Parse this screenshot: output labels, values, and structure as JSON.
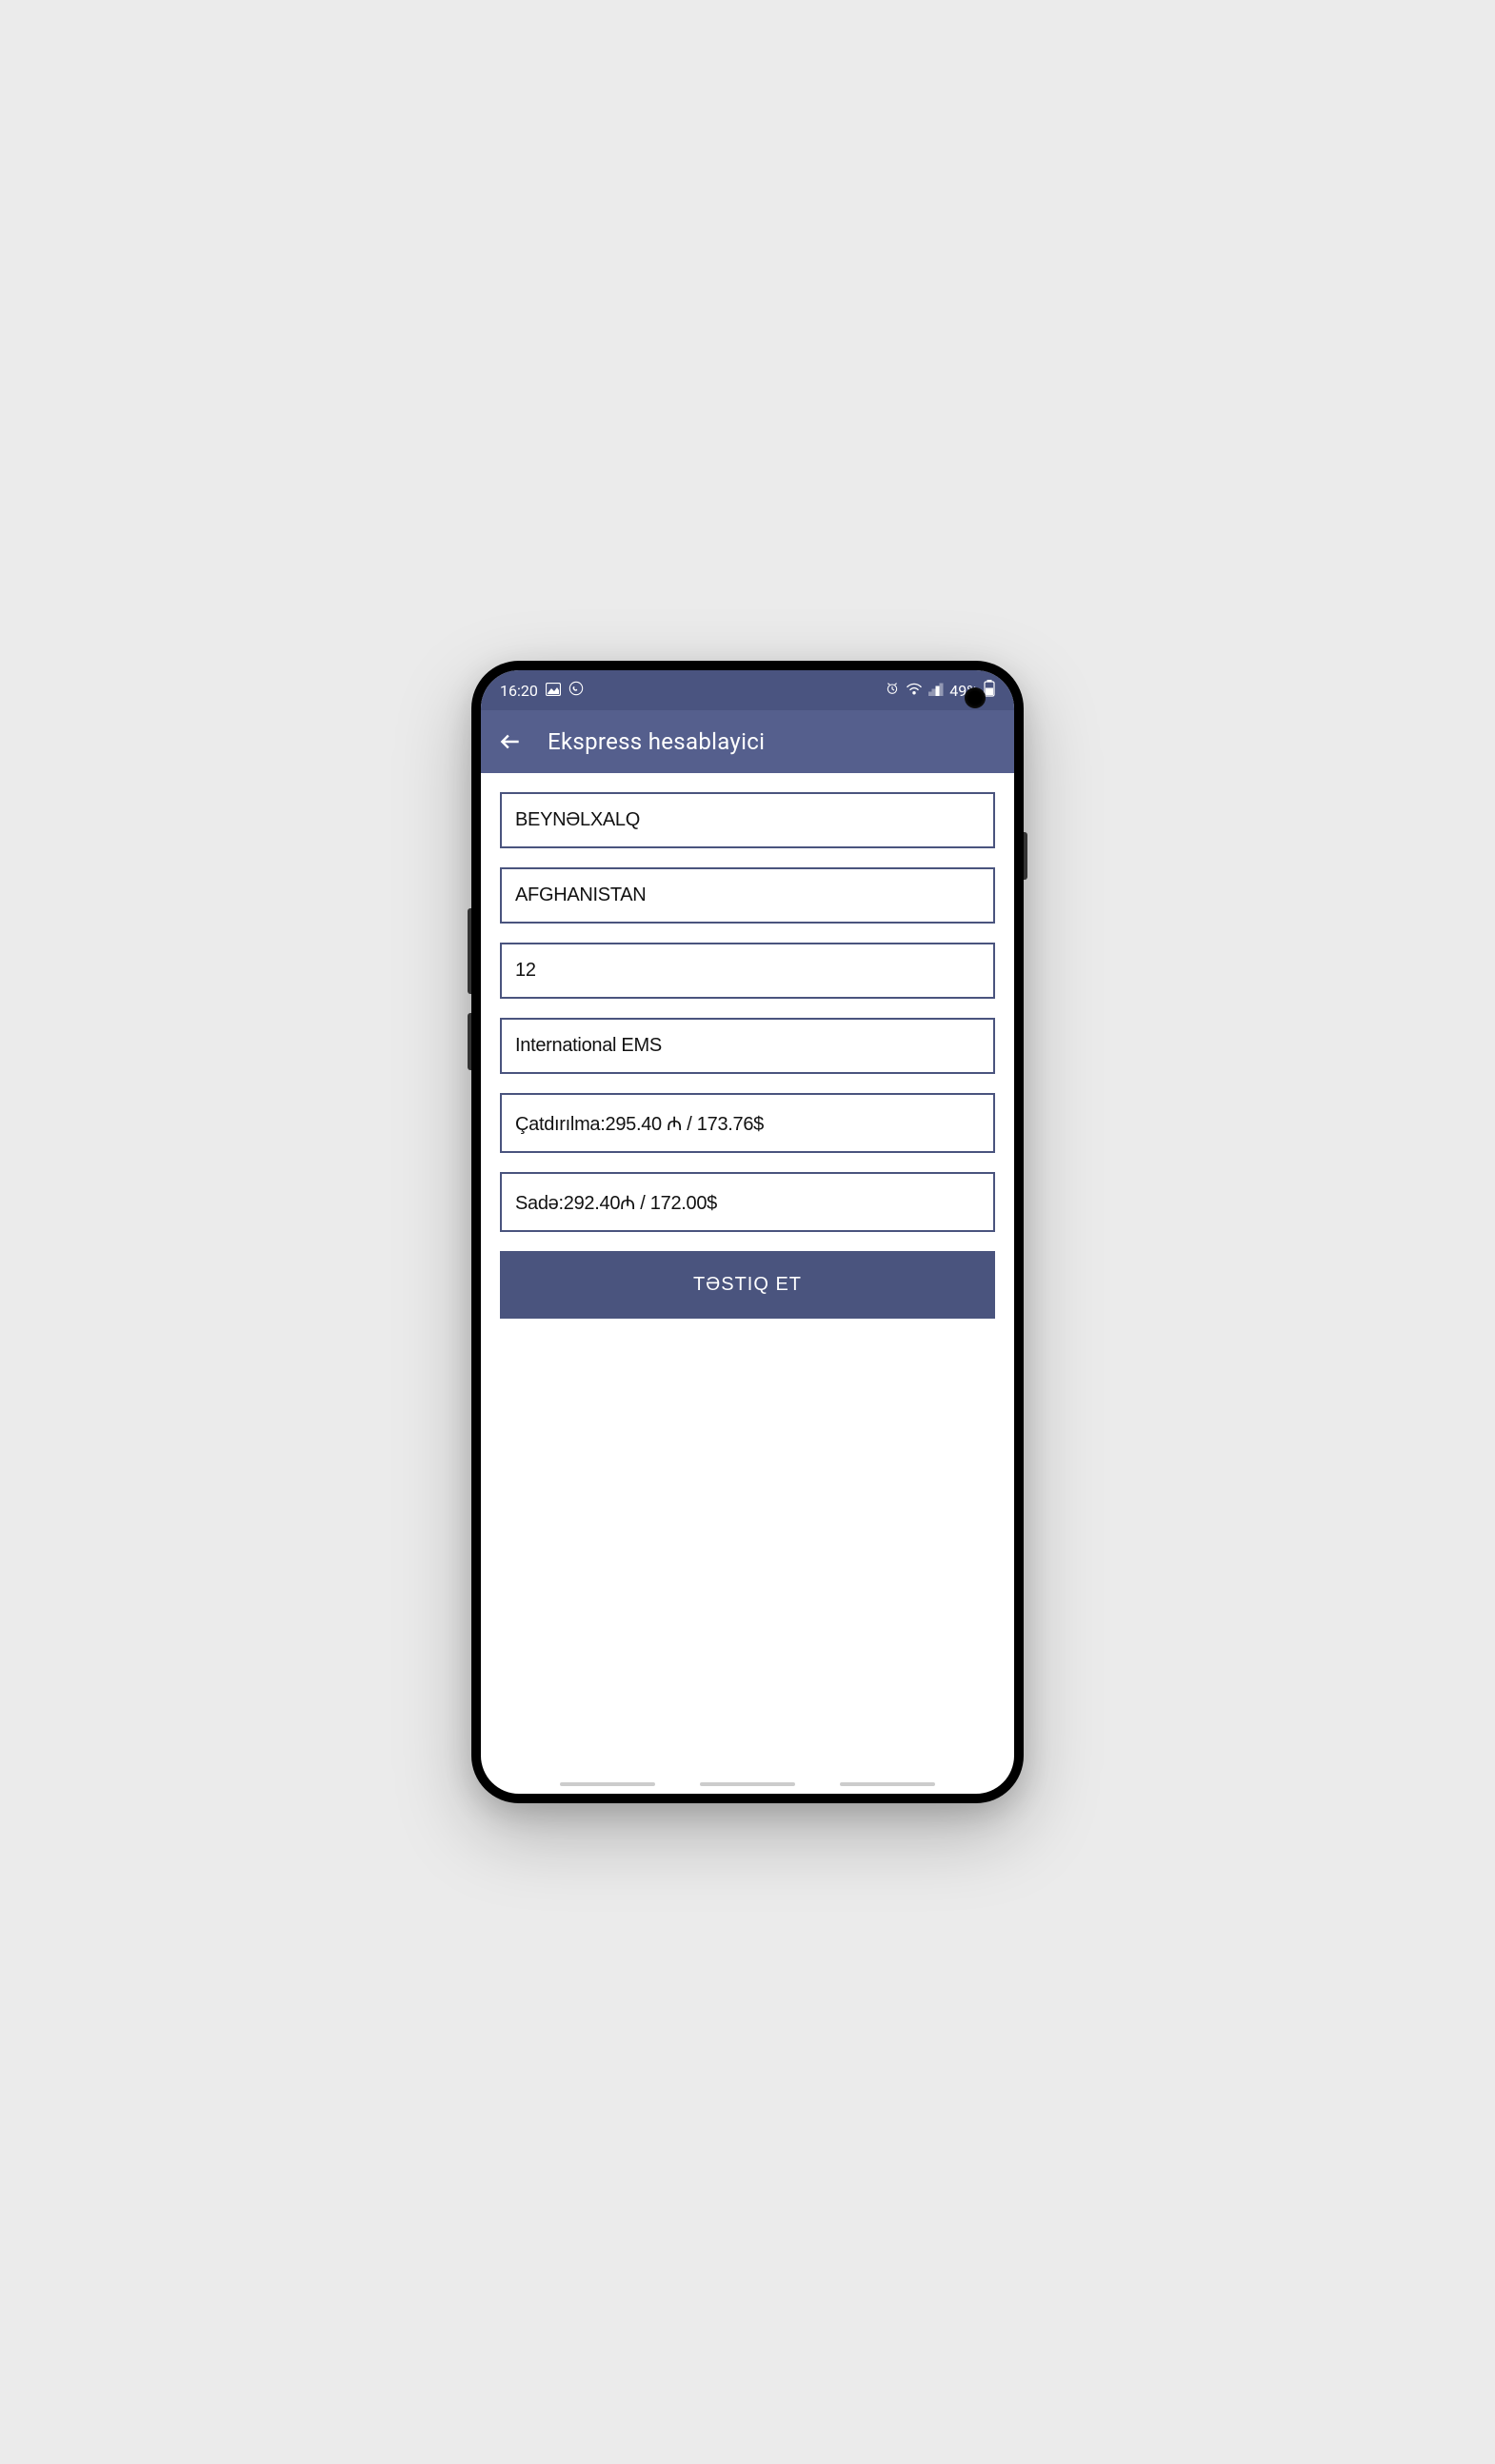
{
  "status": {
    "time": "16:20",
    "battery_percent": "49%",
    "icons": {
      "image": "image-icon",
      "whatsapp": "whatsapp-icon",
      "alarm": "alarm-icon",
      "wifi": "wifi-icon",
      "signal": "signal-icon",
      "battery": "battery-icon"
    }
  },
  "header": {
    "title": "Ekspress hesablayici",
    "back_icon": "back-arrow-icon"
  },
  "fields": {
    "type": "BEYNƏLXALQ",
    "country": "AFGHANISTAN",
    "weight": "12",
    "service": "International EMS",
    "delivery_price": "Çatdırılma:295.40 ₼ / 173.76$",
    "basic_price": "Sadə:292.40₼ / 172.00$"
  },
  "actions": {
    "confirm": "TƏSTIQ ET"
  }
}
